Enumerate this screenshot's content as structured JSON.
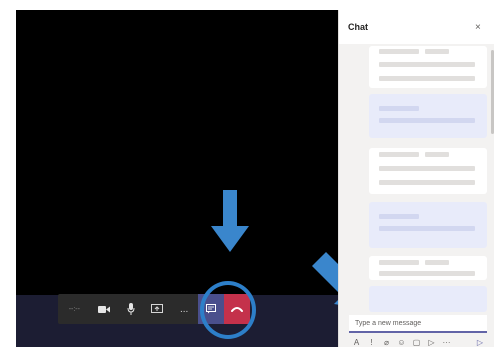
{
  "toolbar": {
    "timer": "--:--",
    "more": "..."
  },
  "chat": {
    "title": "Chat",
    "close": "×",
    "compose": {
      "placeholder": "Type a new message"
    },
    "tools": {
      "format": "A",
      "important": "!",
      "attach": "⌀",
      "emoji": "☺",
      "giphy": "▢",
      "sticker": "▷",
      "more": "···",
      "send": "▷"
    }
  },
  "colors": {
    "stage": "#000000",
    "toolbar": "#2b2b2b",
    "chat_active": "#4a4f8c",
    "hangup": "#c4314b",
    "annotation": "#2d7fc9",
    "accent": "#6264a7"
  },
  "icons": {
    "camera": "video-camera-icon",
    "mic": "microphone-icon",
    "share": "share-screen-icon",
    "chat": "chat-icon",
    "hangup": "hang-up-icon"
  }
}
